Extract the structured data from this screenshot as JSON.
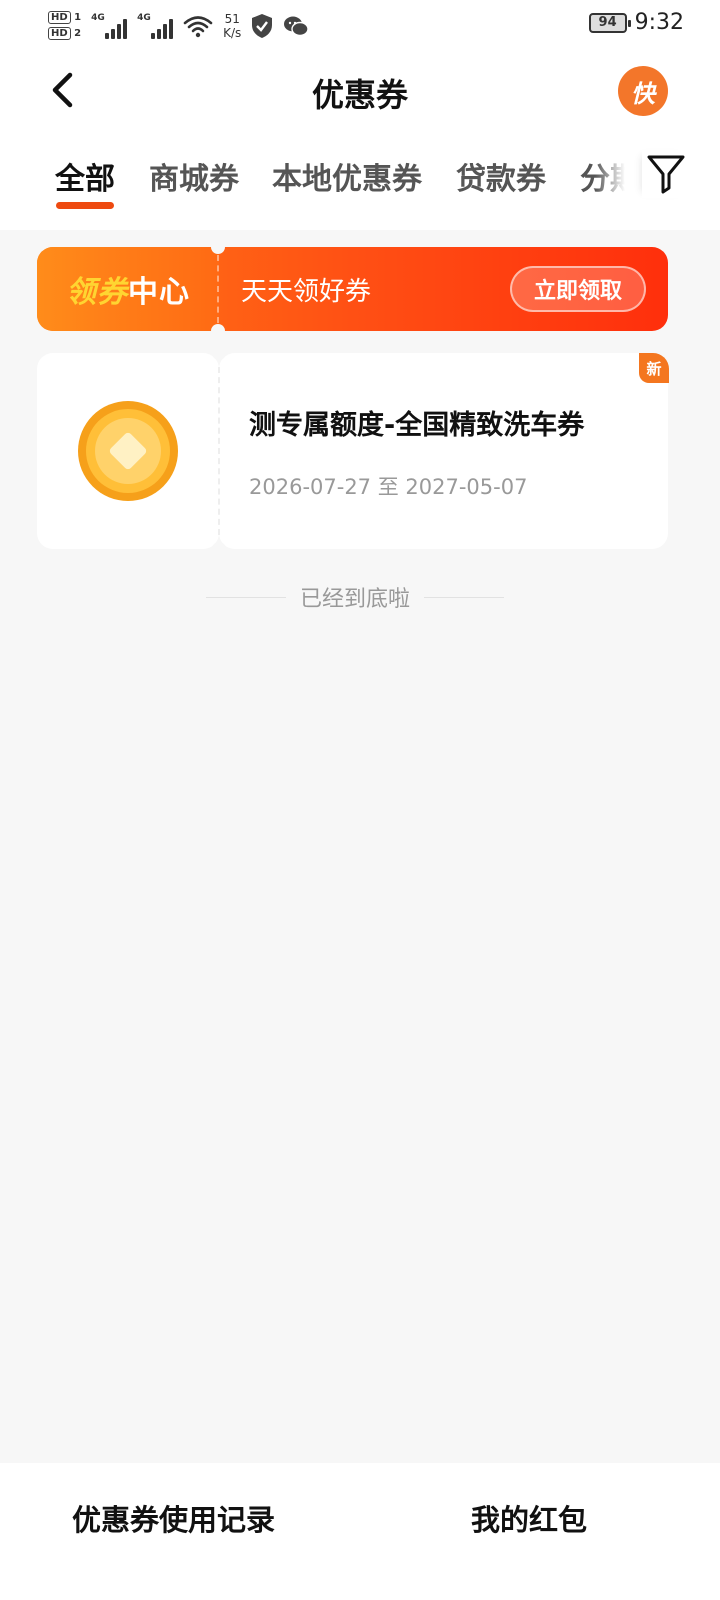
{
  "status_bar": {
    "hd1": "HD",
    "hd1_sub": "1",
    "hd2": "HD",
    "hd2_sub": "2",
    "net1": "4G",
    "net2": "4G",
    "speed_value": "51",
    "speed_unit": "K/s",
    "battery": "94",
    "time": "9:32",
    "icons": [
      "signal-icon",
      "wifi-icon",
      "shield-icon",
      "wechat-icon",
      "battery-icon"
    ]
  },
  "header": {
    "title": "优惠券",
    "badge": "快"
  },
  "tabs": [
    {
      "label": "全部",
      "active": true
    },
    {
      "label": "商城券",
      "active": false
    },
    {
      "label": "本地优惠券",
      "active": false
    },
    {
      "label": "贷款券",
      "active": false
    },
    {
      "label": "分期",
      "active": false
    }
  ],
  "banner": {
    "title_part1": "领券",
    "title_part2": "中心",
    "slogan": "天天领好券",
    "button": "立即领取"
  },
  "coupons": [
    {
      "name": "测专属额度-全国精致洗车券",
      "dates": "2026-07-27 至 2027-05-07",
      "badge": "新"
    }
  ],
  "list_end": "已经到底啦",
  "bottom": {
    "history": "优惠券使用记录",
    "red_packet": "我的红包"
  },
  "colors": {
    "accent": "#ee4a10",
    "banner_start": "#ff7a16",
    "banner_end": "#ff2f0c",
    "coin": "#f8a61e",
    "background": "#f7f7f7"
  }
}
